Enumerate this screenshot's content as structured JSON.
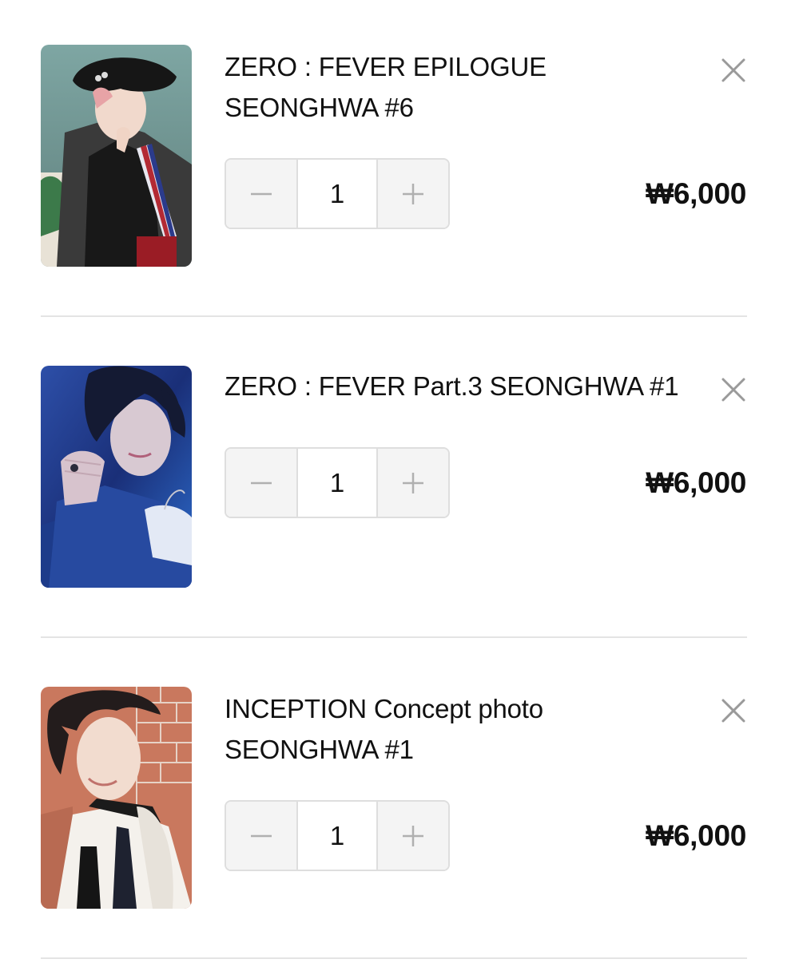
{
  "cart": {
    "items": [
      {
        "title_line1": "ZERO : FEVER EPILOGUE",
        "title_line2": "SEONGHWA #6",
        "quantity": "1",
        "price": "₩6,000",
        "photo_icon": "photocard-image"
      },
      {
        "title_line1": "ZERO : FEVER Part.3 SEONGHWA #1",
        "title_line2": "",
        "quantity": "1",
        "price": "₩6,000",
        "photo_icon": "photocard-image"
      },
      {
        "title_line1": "INCEPTION Concept photo",
        "title_line2": "SEONGHWA #1",
        "quantity": "1",
        "price": "₩6,000",
        "photo_icon": "photocard-image"
      }
    ]
  },
  "colors": {
    "text": "#111111",
    "stepper_bg": "#f4f4f4",
    "border": "#dedede",
    "icon": "#9a9a9a"
  }
}
